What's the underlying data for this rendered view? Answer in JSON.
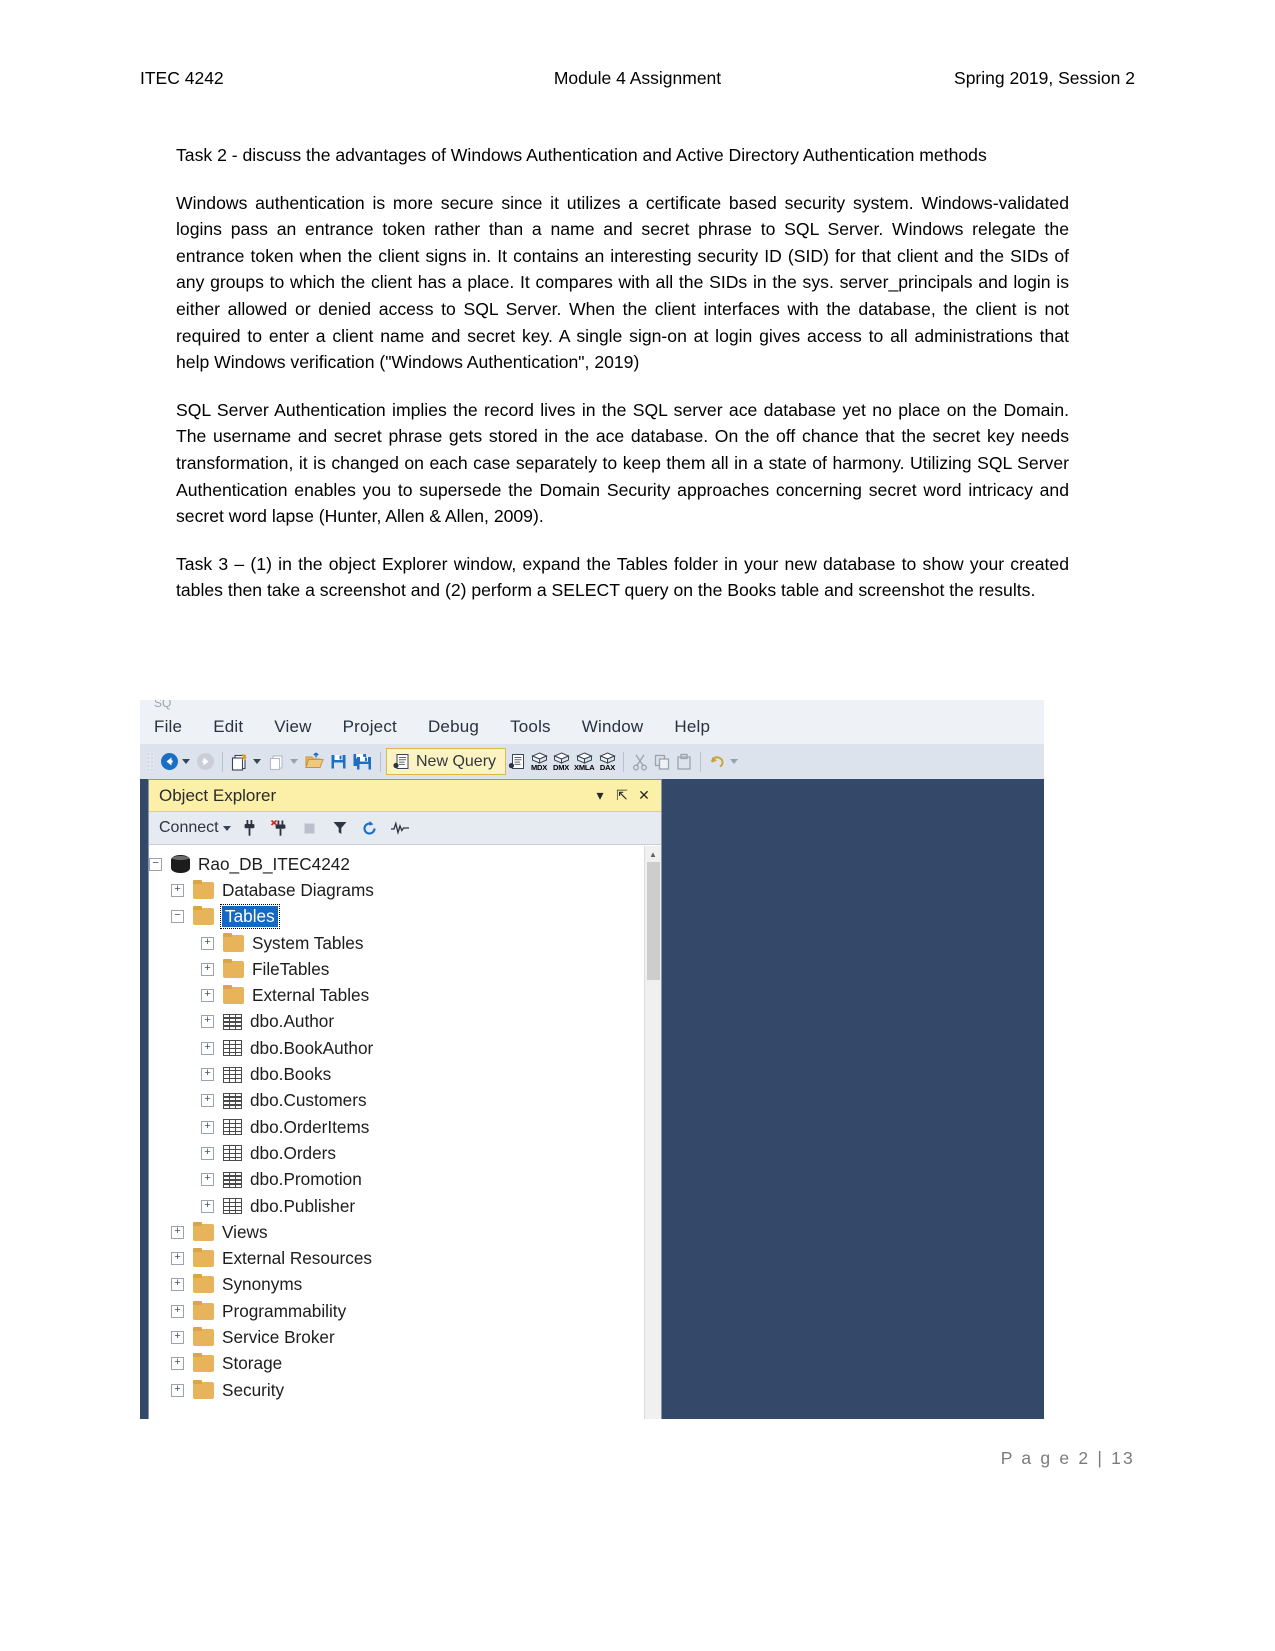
{
  "header": {
    "left": "ITEC 4242",
    "center": "Module 4 Assignment",
    "right": "Spring 2019, Session 2"
  },
  "body": {
    "paragraphs": [
      "Task 2 - discuss the advantages of Windows Authentication and Active Directory Authentication methods",
      "Windows authentication is more secure since it utilizes a certificate based security system. Windows-validated logins pass an entrance token rather than a name and secret phrase to SQL Server. Windows relegate the entrance token when the client signs in. It contains an interesting security ID (SID) for that client and the SIDs of any groups to which the client has a place. It compares with all the SIDs in the sys. server_principals and login is either allowed or denied access to SQL Server. When the client interfaces with the database, the client is not required to enter a client name and secret key. A single sign-on at login gives access to all administrations that help Windows verification (\"Windows Authentication\", 2019)",
      "SQL Server Authentication implies the record lives in the SQL server ace database yet no place on the Domain. The username and secret phrase gets stored in the ace database. On the off chance that the secret key needs transformation, it is changed on each case separately to keep them all in a state of harmony. Utilizing SQL Server Authentication enables you to supersede the Domain Security approaches concerning secret word intricacy and secret word lapse (Hunter, Allen & Allen, 2009).",
      "Task 3 – (1) in the object Explorer window, expand the Tables folder in your new database to show your created tables then take a screenshot and (2) perform a SELECT query on the Books table and screenshot the results."
    ]
  },
  "screenshot": {
    "menubar": [
      {
        "label": "File"
      },
      {
        "label": "Edit"
      },
      {
        "label": "View"
      },
      {
        "label": "Project"
      },
      {
        "label": "Debug"
      },
      {
        "label": "Tools"
      },
      {
        "label": "Window"
      },
      {
        "label": "Help"
      }
    ],
    "toolbar": {
      "new_query_label": "New Query",
      "mdx_label": "MDX",
      "dmx_label": "DMX",
      "xmla_label": "XMLA",
      "dax_label": "DAX"
    },
    "object_explorer": {
      "title": "Object Explorer",
      "connect_label": "Connect",
      "tree": [
        {
          "label": "Rao_DB_ITEC4242",
          "icon": "database-icon",
          "indent": 0,
          "expander": "minus",
          "selected": false
        },
        {
          "label": "Database Diagrams",
          "icon": "folder-icon",
          "indent": 1,
          "expander": "plus",
          "selected": false
        },
        {
          "label": "Tables",
          "icon": "folder-icon",
          "indent": 1,
          "expander": "minus",
          "selected": true
        },
        {
          "label": "System Tables",
          "icon": "folder-icon",
          "indent": 2,
          "expander": "plus",
          "selected": false
        },
        {
          "label": "FileTables",
          "icon": "folder-icon",
          "indent": 2,
          "expander": "plus",
          "selected": false
        },
        {
          "label": "External Tables",
          "icon": "folder-icon",
          "indent": 2,
          "expander": "plus",
          "selected": false
        },
        {
          "label": "dbo.Author",
          "icon": "table-icon",
          "indent": 2,
          "expander": "plus",
          "selected": false
        },
        {
          "label": "dbo.BookAuthor",
          "icon": "table-icon",
          "indent": 2,
          "expander": "plus",
          "selected": false
        },
        {
          "label": "dbo.Books",
          "icon": "table-icon",
          "indent": 2,
          "expander": "plus",
          "selected": false
        },
        {
          "label": "dbo.Customers",
          "icon": "table-icon",
          "indent": 2,
          "expander": "plus",
          "selected": false
        },
        {
          "label": "dbo.OrderItems",
          "icon": "table-icon",
          "indent": 2,
          "expander": "plus",
          "selected": false
        },
        {
          "label": "dbo.Orders",
          "icon": "table-icon",
          "indent": 2,
          "expander": "plus",
          "selected": false
        },
        {
          "label": "dbo.Promotion",
          "icon": "table-icon",
          "indent": 2,
          "expander": "plus",
          "selected": false
        },
        {
          "label": "dbo.Publisher",
          "icon": "table-icon",
          "indent": 2,
          "expander": "plus",
          "selected": false
        },
        {
          "label": "Views",
          "icon": "folder-icon",
          "indent": 1,
          "expander": "plus",
          "selected": false
        },
        {
          "label": "External Resources",
          "icon": "folder-icon",
          "indent": 1,
          "expander": "plus",
          "selected": false
        },
        {
          "label": "Synonyms",
          "icon": "folder-icon",
          "indent": 1,
          "expander": "plus",
          "selected": false
        },
        {
          "label": "Programmability",
          "icon": "folder-icon",
          "indent": 1,
          "expander": "plus",
          "selected": false
        },
        {
          "label": "Service Broker",
          "icon": "folder-icon",
          "indent": 1,
          "expander": "plus",
          "selected": false
        },
        {
          "label": "Storage",
          "icon": "folder-icon",
          "indent": 1,
          "expander": "plus",
          "selected": false
        },
        {
          "label": "Security",
          "icon": "folder-icon",
          "indent": 1,
          "expander": "plus",
          "selected": false
        }
      ]
    },
    "colors": {
      "editor_background": "#34496a",
      "panel_title": "#fcf0a8",
      "new_query_highlight": "#fdf3c2",
      "selection": "#1669c1"
    }
  },
  "footer": {
    "text": "P a g e  2 | 13"
  }
}
